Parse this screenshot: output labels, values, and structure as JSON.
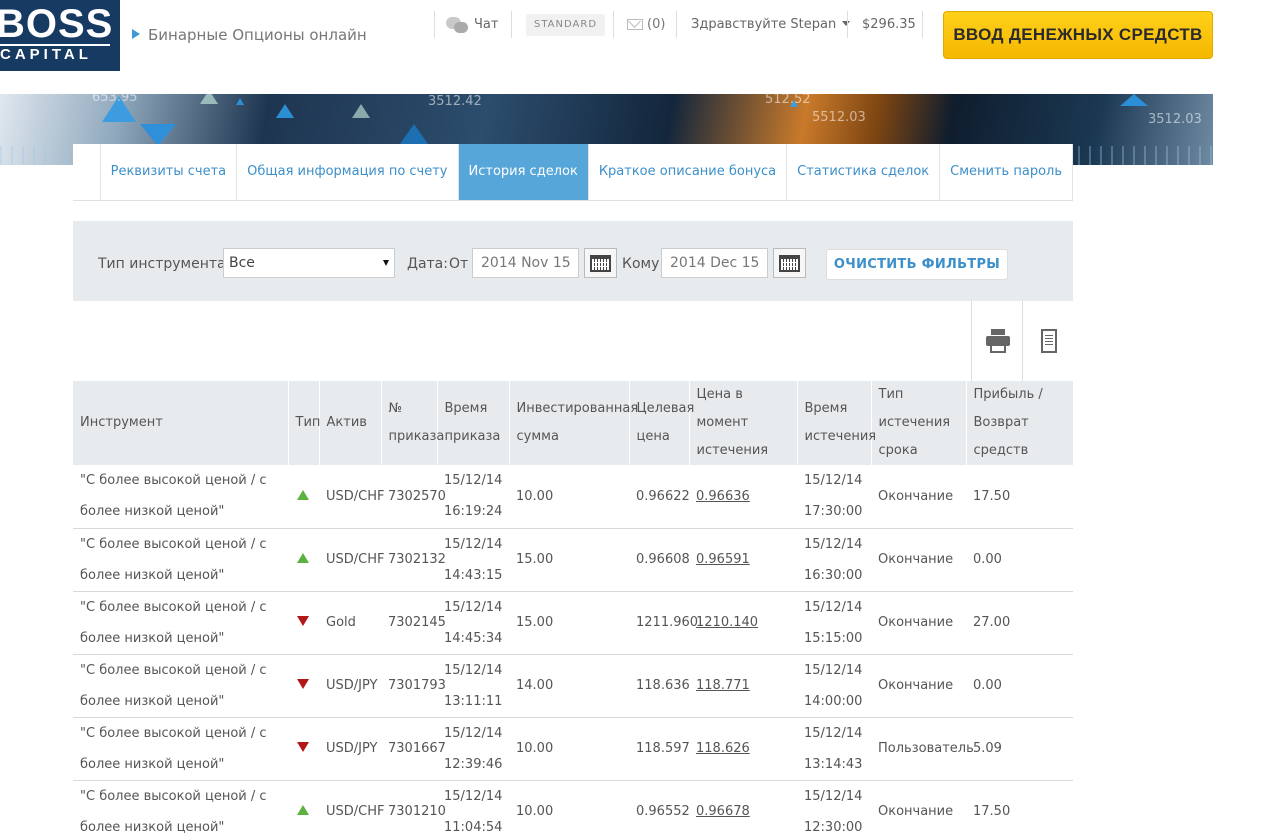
{
  "brand": {
    "logo_top": "BOSS",
    "logo_bottom": "CAPITAL",
    "tagline": "Бинарные Опционы онлайн"
  },
  "header": {
    "chat_label": "Чат",
    "account_badge": "STANDARD",
    "messages_count": "(0)",
    "greeting": "Здравствуйте Stepan",
    "balance": "$296.35",
    "deposit_button": "ВВОД ДЕНЕЖНЫХ СРЕДСТВ"
  },
  "banner": {
    "tickers": [
      "3512.42",
      "512.52",
      "5512.03",
      "3512.03",
      "653.95"
    ]
  },
  "tabs": [
    {
      "label": "Реквизиты счета"
    },
    {
      "label": "Общая информация по счету"
    },
    {
      "label": "История сделок"
    },
    {
      "label": "Краткое описание бонуса"
    },
    {
      "label": "Статистика сделок"
    },
    {
      "label": "Сменить пароль"
    }
  ],
  "active_tab": "История сделок",
  "filters": {
    "instrument_type_label": "Тип инструмента",
    "instrument_type_value": "Все",
    "date_label": "Дата:",
    "from_label": "От",
    "from_value": "2014 Nov 15",
    "to_label": "Кому",
    "to_value": "2014 Dec 15",
    "clear_button": "ОЧИСТИТЬ ФИЛЬТРЫ"
  },
  "table": {
    "headers": {
      "instrument": "Инструмент",
      "type": "Тип",
      "asset": "Актив",
      "order_no": "№ приказа",
      "order_time": "Время приказа",
      "invested": "Инвестированная сумма",
      "target": "Целевая цена",
      "expiry_price": "Цена в момент истечения",
      "expiry_time": "Время истечения",
      "expiry_type": "Тип истечения срока",
      "profit": "Прибыль / Возврат средств"
    },
    "rows": [
      {
        "instrument": "\"С более высокой ценой / с более низкой ценой\"",
        "direction": "up",
        "asset": "USD/CHF",
        "order": "7302570",
        "order_time": "15/12/14 16:19:24",
        "invested": "10.00",
        "target": "0.96622",
        "expiry_price": "0.96636",
        "expiry_time": "15/12/14 17:30:00",
        "expiry_type": "Окончание",
        "profit": "17.50"
      },
      {
        "instrument": "\"С более высокой ценой / с более низкой ценой\"",
        "direction": "up",
        "asset": "USD/CHF",
        "order": "7302132",
        "order_time": "15/12/14 14:43:15",
        "invested": "15.00",
        "target": "0.96608",
        "expiry_price": "0.96591",
        "expiry_time": "15/12/14 16:30:00",
        "expiry_type": "Окончание",
        "profit": "0.00"
      },
      {
        "instrument": "\"С более высокой ценой / с более низкой ценой\"",
        "direction": "down",
        "asset": "Gold",
        "order": "7302145",
        "order_time": "15/12/14 14:45:34",
        "invested": "15.00",
        "target": "1211.960",
        "expiry_price": "1210.140",
        "expiry_time": "15/12/14 15:15:00",
        "expiry_type": "Окончание",
        "profit": "27.00"
      },
      {
        "instrument": "\"С более высокой ценой / с более низкой ценой\"",
        "direction": "down",
        "asset": "USD/JPY",
        "order": "7301793",
        "order_time": "15/12/14 13:11:11",
        "invested": "14.00",
        "target": "118.636",
        "expiry_price": "118.771",
        "expiry_time": "15/12/14 14:00:00",
        "expiry_type": "Окончание",
        "profit": "0.00"
      },
      {
        "instrument": "\"С более высокой ценой / с более низкой ценой\"",
        "direction": "down",
        "asset": "USD/JPY",
        "order": "7301667",
        "order_time": "15/12/14 12:39:46",
        "invested": "10.00",
        "target": "118.597",
        "expiry_price": "118.626",
        "expiry_time": "15/12/14 13:14:43",
        "expiry_type": "Пользователь",
        "profit": "5.09"
      },
      {
        "instrument": "\"С более высокой ценой / с более низкой ценой\"",
        "direction": "up",
        "asset": "USD/CHF",
        "order": "7301210",
        "order_time": "15/12/14 11:04:54",
        "invested": "10.00",
        "target": "0.96552",
        "expiry_price": "0.96678",
        "expiry_time": "15/12/14 12:30:00",
        "expiry_type": "Окончание",
        "profit": "17.50"
      }
    ]
  },
  "colors": {
    "accent": "#57a6d9",
    "link": "#3c8fc9",
    "deposit": "#f9c20e",
    "up": "#5cb23f",
    "down": "#b21818",
    "logo_bg": "#163a61"
  }
}
